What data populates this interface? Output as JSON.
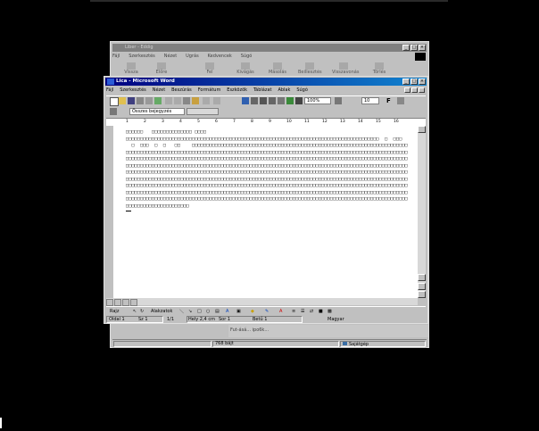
{
  "back_window": {
    "title": "Liber - Eddig",
    "menu": [
      "Fájl",
      "Szerkesztés",
      "Nézet",
      "Ugrás",
      "Kedvencek",
      "Súgó"
    ],
    "toolbar": [
      "Vissza",
      "Előre",
      "Fel",
      "Kivágás",
      "Másolás",
      "Beillesztés",
      "Visszavonás",
      "Törlés"
    ],
    "status_size": "768 bájt",
    "status_location": "Sajátgép",
    "tray_text": "Fut-ásá... ipo6k..."
  },
  "word": {
    "title": "Lica - Microsoft Word",
    "menu": [
      "Fájl",
      "Szerkesztés",
      "Nézet",
      "Beszúrás",
      "Formátum",
      "Eszközök",
      "Táblázat",
      "Ablak",
      "Súgó"
    ],
    "zoom": "100%",
    "font_size": "10",
    "style": "Összes bejegyzés",
    "ruler_ticks": [
      "1",
      "2",
      "3",
      "4",
      "5",
      "6",
      "7",
      "8",
      "9",
      "10",
      "11",
      "12",
      "13",
      "14",
      "15",
      "16"
    ],
    "doc_lines": [
      "□□□□□□   □□□□□□□□□□□□□□ □□□□",
      "□□□□□□□□□□□□□□□□□□□□□□□□□□□□□□□□□□□□□□□□□□□□□□□□□□□□□□□□□□□□□□□□□□□□□□□□□□□□□□□□□□□□□□□□  □  □□□",
      "  □  □□□  □  □   □□    □□□□□□□□□□□□□□□□□□□□□□□□□□□□□□□□□□□□□□□□□□□□□□□□□□□□□□□□□□□□□□□□□□□□□□□□□□□",
      "□□□□□□□□□□□□□□□□□□□□□□□□□□□□□□□□□□□□□□□□□□□□□□□□□□□□□□□□□□□□□□□□□□□□□□□□□□□□□□□□□□□□□□□□□□□□□□□□□□",
      "□□□□□□□□□□□□□□□□□□□□□□□□□□□□□□□□□□□□□□□□□□□□□□□□□□□□□□□□□□□□□□□□□□□□□□□□□□□□□□□□□□□□□□□□□□□□□□□□□□",
      "□□□□□□□□□□□□□□□□□□□□□□□□□□□□□□□□□□□□□□□□□□□□□□□□□□□□□□□□□□□□□□□□□□□□□□□□□□□□□□□□□□□□□□□□□□□□□□□□□□",
      "□□□□□□□□□□□□□□□□□□□□□□□□□□□□□□□□□□□□□□□□□□□□□□□□□□□□□□□□□□□□□□□□□□□□□□□□□□□□□□□□□□□□□□□□□□□□□□□□□□",
      "□□□□□□□□□□□□□□□□□□□□□□□□□□□□□□□□□□□□□□□□□□□□□□□□□□□□□□□□□□□□□□□□□□□□□□□□□□□□□□□□□□□□□□□□□□□□□□□□□□",
      "□□□□□□□□□□□□□□□□□□□□□□□□□□□□□□□□□□□□□□□□□□□□□□□□□□□□□□□□□□□□□□□□□□□□□□□□□□□□□□□□□□□□□□□□□□□□□□□□□□",
      "□□□□□□□□□□□□□□□□□□□□□□□□□□□□□□□□□□□□□□□□□□□□□□□□□□□□□□□□□□□□□□□□□□□□□□□□□□□□□□□□□□□□□□□□□□□□□□□□□□",
      "□□□□□□□□□□□□□□□□□□□□□□□□□□□□□□□□□□□□□□□□□□□□□□□□□□□□□□□□□□□□□□□□□□□□□□□□□□□□□□□□□□□□□□□□□□□□□□□□□□",
      "□□□□□□□□□□□□□□□□□□□□□□"
    ],
    "drawbar": {
      "draw": "Rajz",
      "autoshapes": "Alakzatok"
    },
    "status": {
      "page": "Oldal 1",
      "section": "Sz 1",
      "pages": "1/1",
      "position": "Hely 2,4 cm",
      "line": "Sor 1",
      "column": "Betű 1",
      "language": "Magyar"
    }
  }
}
